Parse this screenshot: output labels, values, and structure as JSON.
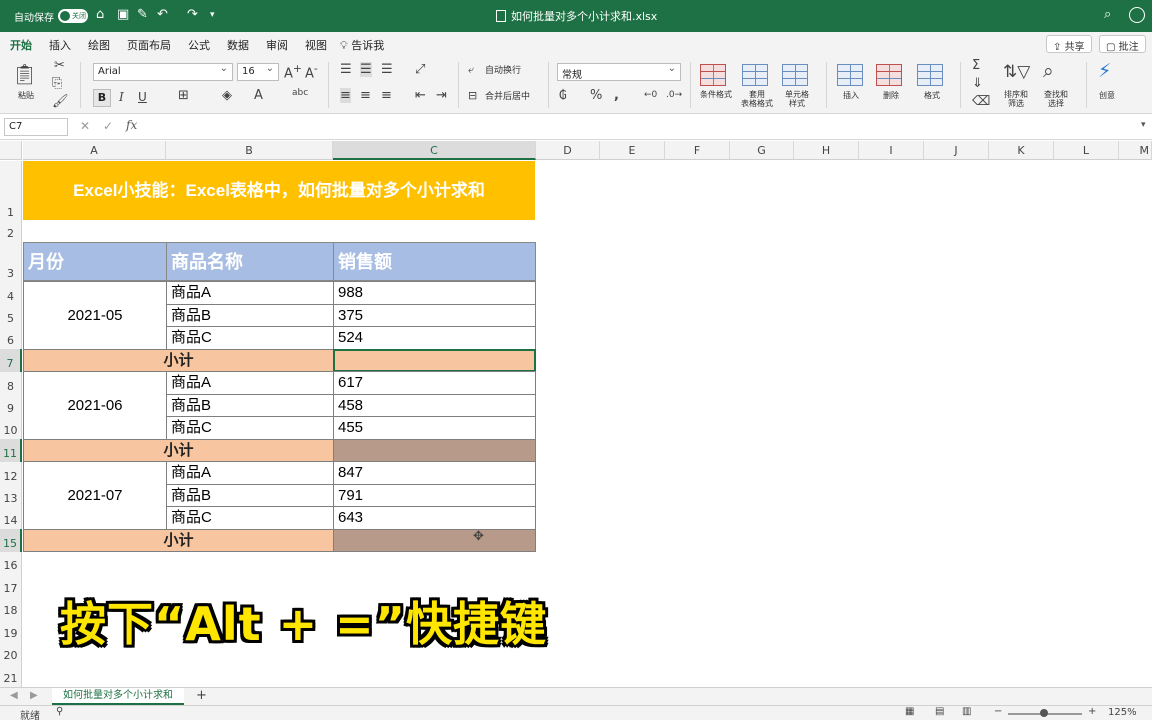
{
  "titlebar": {
    "autosave_label": "自动保存",
    "autosave_state": "关闭",
    "document_title": "如何批量对多个小计求和.xlsx"
  },
  "ribbon": {
    "tabs": [
      "开始",
      "插入",
      "绘图",
      "页面布局",
      "公式",
      "数据",
      "审阅",
      "视图"
    ],
    "tell_me": "告诉我",
    "share_label": "共享",
    "comments_label": "批注",
    "paste_label": "粘贴",
    "font_name": "Arial",
    "font_size": "16",
    "wrap_text": "自动换行",
    "merge_center": "合并后居中",
    "number_format": "常规",
    "conditional_format": "条件格式",
    "table_format": "套用\n表格格式",
    "cell_style": "单元格\n样式",
    "insert": "插入",
    "delete": "删除",
    "format": "格式",
    "sort_filter": "排序和\n筛选",
    "find_select": "查找和\n选择",
    "ideas": "创意"
  },
  "formula_bar": {
    "name_box": "C7",
    "formula": ""
  },
  "columns": [
    "A",
    "B",
    "C",
    "D",
    "E",
    "F",
    "G",
    "H",
    "I",
    "J",
    "K",
    "L",
    "M"
  ],
  "rows": [
    "1",
    "2",
    "3",
    "4",
    "5",
    "6",
    "7",
    "8",
    "9",
    "10",
    "11",
    "12",
    "13",
    "14",
    "15",
    "16",
    "17",
    "18",
    "19",
    "20",
    "21"
  ],
  "sheet": {
    "title": "Excel小技能：Excel表格中，如何批量对多个小计求和",
    "headers": [
      "月份",
      "商品名称",
      "销售额"
    ],
    "groups": [
      {
        "month": "2021-05",
        "items": [
          {
            "name": "商品A",
            "value": "988"
          },
          {
            "name": "商品B",
            "value": "375"
          },
          {
            "name": "商品C",
            "value": "524"
          }
        ]
      },
      {
        "month": "2021-06",
        "items": [
          {
            "name": "商品A",
            "value": "617"
          },
          {
            "name": "商品B",
            "value": "458"
          },
          {
            "name": "商品C",
            "value": "455"
          }
        ]
      },
      {
        "month": "2021-07",
        "items": [
          {
            "name": "商品A",
            "value": "847"
          },
          {
            "name": "商品B",
            "value": "791"
          },
          {
            "name": "商品C",
            "value": "643"
          }
        ]
      }
    ],
    "subtotal_label": "小计"
  },
  "caption": "按下“Alt + =”快捷键",
  "sheet_tab": "如何批量对多个小计求和",
  "status": {
    "mode": "就绪",
    "zoom": "125%"
  },
  "colors": {
    "excel_green": "#1e7145",
    "title_fill": "#ffc000",
    "header_fill": "#a8bde3",
    "subtotal_fill": "#f7c5a0",
    "selection_fill": "#b89a8a",
    "caption_color": "#ffe600"
  }
}
